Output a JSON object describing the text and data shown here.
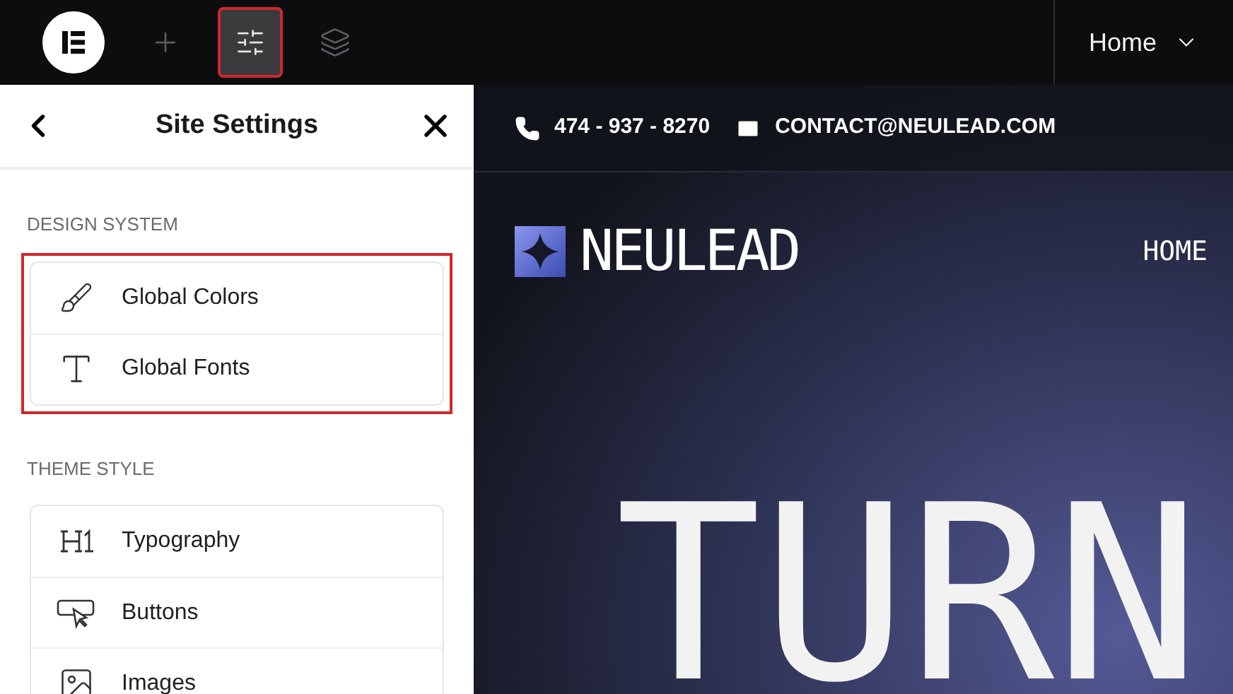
{
  "toolbar": {
    "buttons": [
      {
        "kind": "add",
        "selected": false,
        "highlighted": false
      },
      {
        "kind": "settings",
        "selected": true,
        "highlighted": true
      },
      {
        "kind": "layers",
        "selected": false,
        "highlighted": false
      }
    ],
    "page_selector": "Home"
  },
  "panel": {
    "title": "Site Settings",
    "sections": [
      {
        "heading": "DESIGN SYSTEM",
        "highlighted": true,
        "items": [
          {
            "kind": "brush",
            "label": "Global Colors"
          },
          {
            "kind": "font",
            "label": "Global Fonts"
          }
        ]
      },
      {
        "heading": "THEME STYLE",
        "highlighted": false,
        "items": [
          {
            "kind": "heading",
            "label": "Typography"
          },
          {
            "kind": "button",
            "label": "Buttons"
          },
          {
            "kind": "image",
            "label": "Images"
          }
        ]
      }
    ]
  },
  "preview": {
    "phone": "474 - 937 - 8270",
    "email": "CONTACT@NEULEAD.COM",
    "brand": "NEULEAD",
    "nav": [
      "HOME"
    ],
    "hero_title": "TURN"
  }
}
